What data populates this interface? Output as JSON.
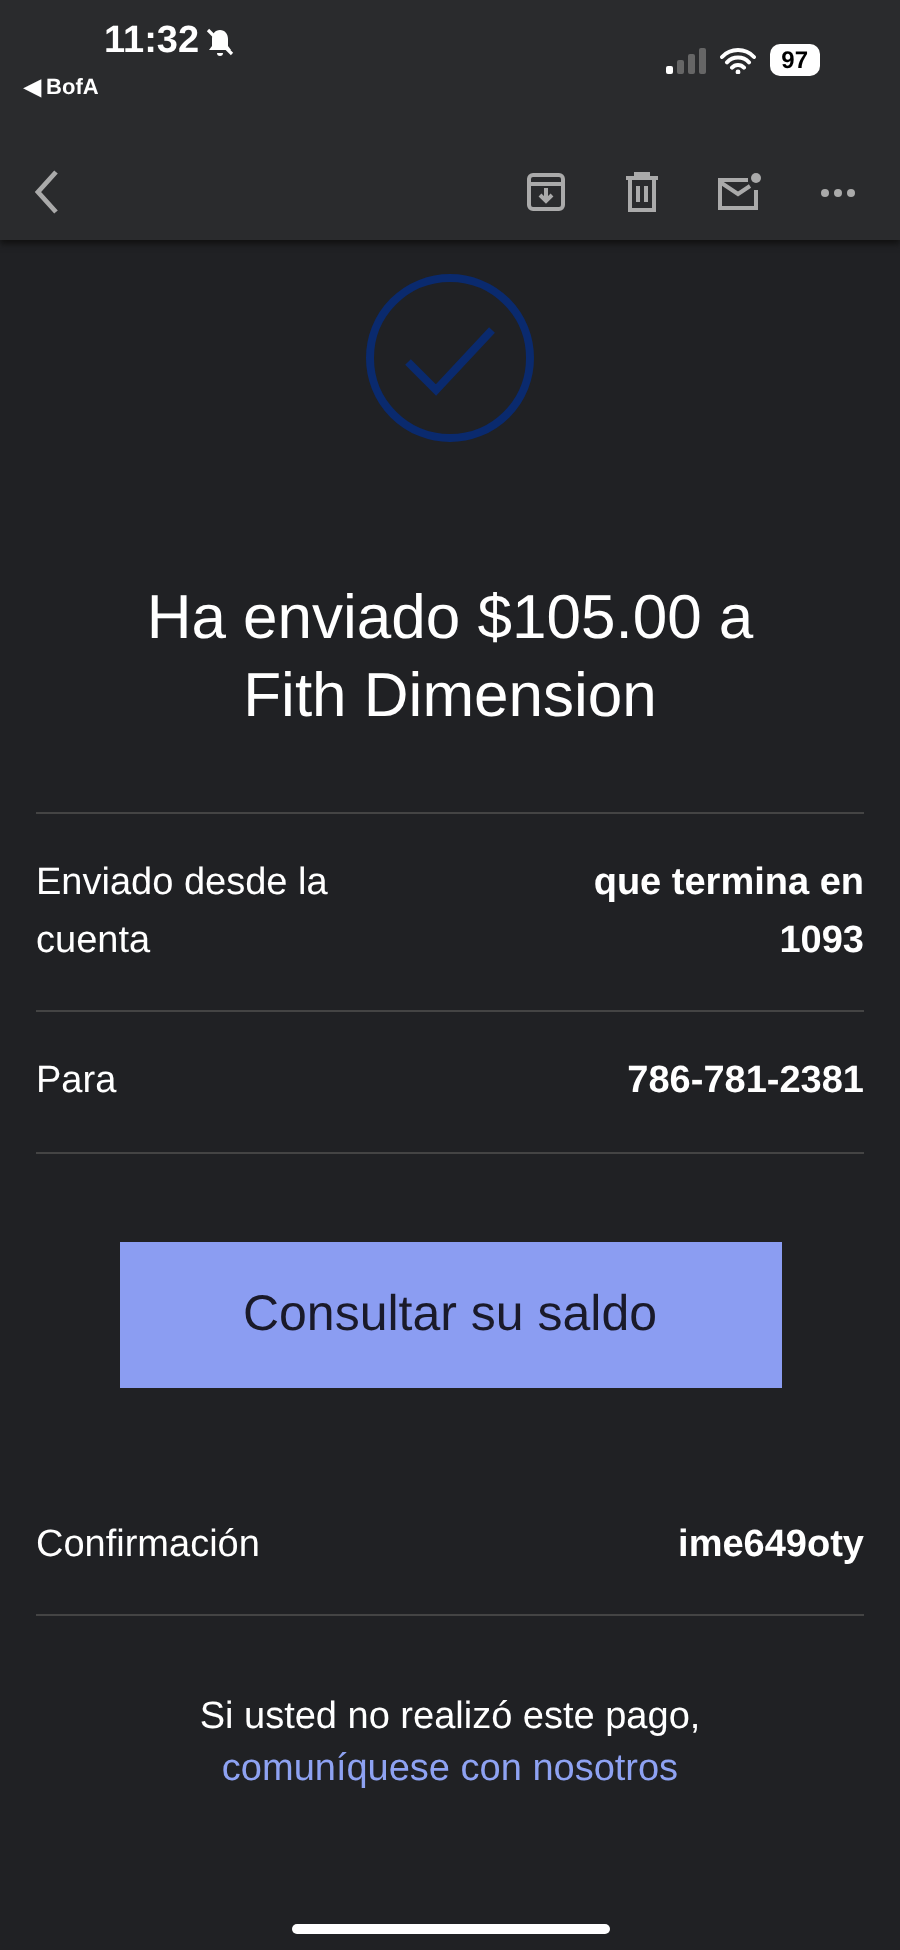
{
  "status_bar": {
    "time": "11:32",
    "back_app": "◀ BofA",
    "battery": "97"
  },
  "headline": "Ha enviado $105.00 a Fith Dimension",
  "details": [
    {
      "label": "Enviado desde la cuenta",
      "value": "que termina en 1093"
    },
    {
      "label": "Para",
      "value": "786-781-2381"
    }
  ],
  "button": "Consultar su saldo",
  "confirmation": {
    "label": "Confirmación",
    "value": "ime649oty"
  },
  "footer": {
    "text": "Si usted no realizó este pago,",
    "link": "comuníquese con nosotros"
  }
}
